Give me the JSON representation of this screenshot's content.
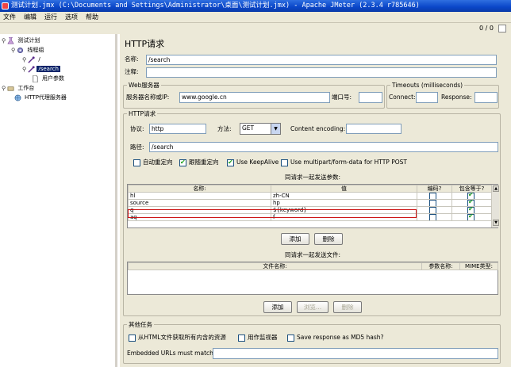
{
  "window": {
    "title": "测试计划.jmx (C:\\Documents and Settings\\Administrator\\桌面\\测试计划.jmx) - Apache JMeter (2.3.4 r785646)"
  },
  "menu": [
    "文件",
    "编辑",
    "运行",
    "选项",
    "帮助"
  ],
  "toolbar": {
    "count": "0 / 0"
  },
  "tree": {
    "test_plan": "测试计划",
    "thread_group": "线程组",
    "sampler_root": "/",
    "sampler_search": "/search",
    "user_params": "用户参数",
    "workbench": "工作台",
    "proxy": "HTTP代理服务器"
  },
  "panel": {
    "title": "HTTP请求",
    "name_label": "名称:",
    "name_value": "/search",
    "comment_label": "注释:",
    "comment_value": ""
  },
  "web_server": {
    "group_title": "Web服务器",
    "host_label": "服务器名称或IP:",
    "host_value": "www.google.cn",
    "port_label": "端口号:",
    "port_value": ""
  },
  "timeouts": {
    "group_title": "Timeouts (milliseconds)",
    "connect_label": "Connect:",
    "connect_value": "",
    "response_label": "Response:",
    "response_value": ""
  },
  "http": {
    "group_title": "HTTP请求",
    "protocol_label": "协议:",
    "protocol_value": "http",
    "method_label": "方法:",
    "method_value": "GET",
    "encoding_label": "Content encoding:",
    "encoding_value": "",
    "path_label": "路径:",
    "path_value": "/search",
    "checkboxes": [
      {
        "label": "自动重定向",
        "checked": false
      },
      {
        "label": "跟随重定向",
        "checked": true
      },
      {
        "label": "Use KeepAlive",
        "checked": true
      },
      {
        "label": "Use multipart/form-data for HTTP POST",
        "checked": false
      }
    ]
  },
  "params": {
    "heading": "同请求一起发送参数:",
    "columns": [
      "名称:",
      "值",
      "编码?",
      "包含等于?"
    ],
    "rows": [
      {
        "name": "hl",
        "value": "zh-CN",
        "encode": false,
        "include_equals": true
      },
      {
        "name": "source",
        "value": "hp",
        "encode": false,
        "include_equals": true
      },
      {
        "name": "q",
        "value": "${keyword}",
        "encode": false,
        "include_equals": true
      },
      {
        "name": "aq",
        "value": "f",
        "encode": false,
        "include_equals": true
      }
    ],
    "add_label": "添加",
    "delete_label": "删除"
  },
  "files": {
    "heading": "同请求一起发送文件:",
    "columns": [
      "文件名称:",
      "参数名称:",
      "MIME类型:"
    ],
    "add_label": "添加",
    "browse_label": "浏览...",
    "delete_label": "删除"
  },
  "other": {
    "group_title": "其他任务",
    "embedded_label": "从HTML文件获取所有内含的资源",
    "monitor_label": "用作监视器",
    "md5_label": "Save response as MD5 hash?",
    "embedded_match_label": "Embedded URLs must match:",
    "embedded_match_value": ""
  },
  "colors": {
    "title_blue": "#0a46c8",
    "panel_bg": "#ece9d8",
    "highlight_red": "#cc1111",
    "selection": "#0a246a"
  }
}
